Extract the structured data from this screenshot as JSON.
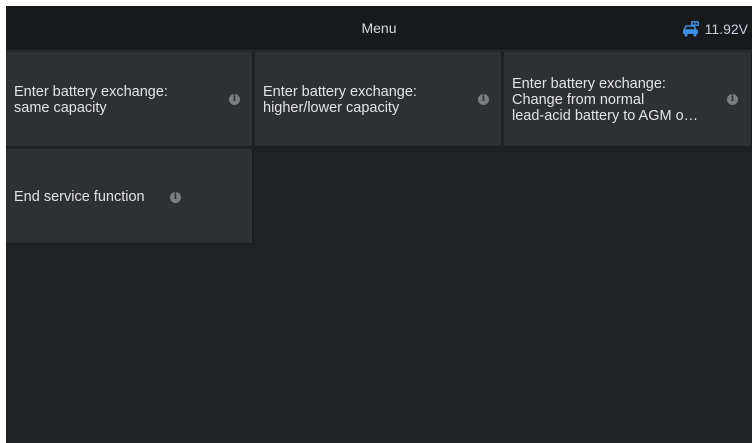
{
  "header": {
    "title": "Menu",
    "voltage": "11.92V",
    "voltage_icon": "car-battery-icon",
    "accent_color": "#3a8fe0"
  },
  "menu": {
    "items": [
      {
        "label": "Enter battery exchange:\nsame capacity",
        "info_icon": "info-icon"
      },
      {
        "label": "Enter battery exchange:\nhigher/lower capacity",
        "info_icon": "info-icon"
      },
      {
        "label": "Enter battery exchange:\nChange from normal\nlead-acid battery to AGM o…",
        "info_icon": "info-icon"
      },
      {
        "label": "End service function",
        "info_icon": "info-icon"
      }
    ]
  }
}
